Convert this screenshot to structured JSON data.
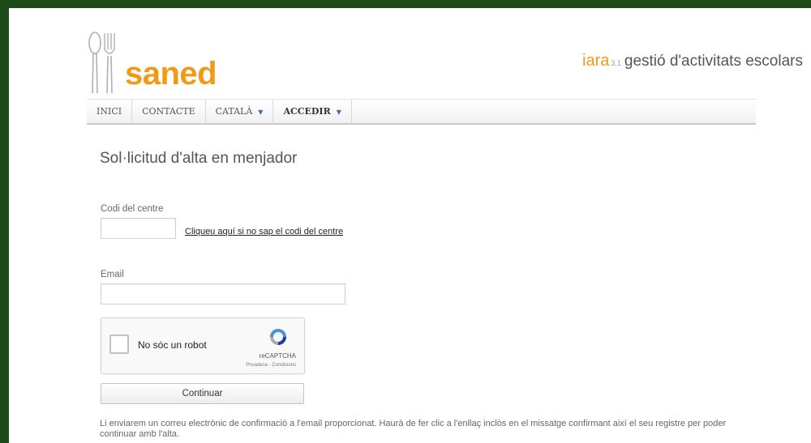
{
  "header": {
    "logo_text": "saned",
    "tagline_brand": "iara",
    "tagline_version": "3.1",
    "tagline_text": "gestió d'activitats escolars"
  },
  "nav": {
    "items": [
      {
        "label": "INICI"
      },
      {
        "label": "CONTACTE"
      },
      {
        "label": "CATALÀ"
      },
      {
        "label": "ACCEDIR"
      }
    ]
  },
  "main": {
    "title": "Sol·licitud d'alta en menjador",
    "centre_code_label": "Codi del centre",
    "centre_code_value": "",
    "centre_code_help_link": "Cliqueu aquí si no sap el codi del centre",
    "email_label": "Email",
    "email_value": "",
    "submit_label": "Continuar",
    "notice": "Li enviarem un correu electrònic de confirmació a l'email proporcionat. Haurà de fer clic a l'enllaç inclòs en el missatge confirmant així el seu registre per poder continuar amb l'alta."
  },
  "recaptcha": {
    "label": "No sóc un robot",
    "brand": "reCAPTCHA",
    "terms": "Privadesa - Condicions"
  },
  "colors": {
    "accent": "#f29a17",
    "frame_border": "#1e4a1a"
  }
}
